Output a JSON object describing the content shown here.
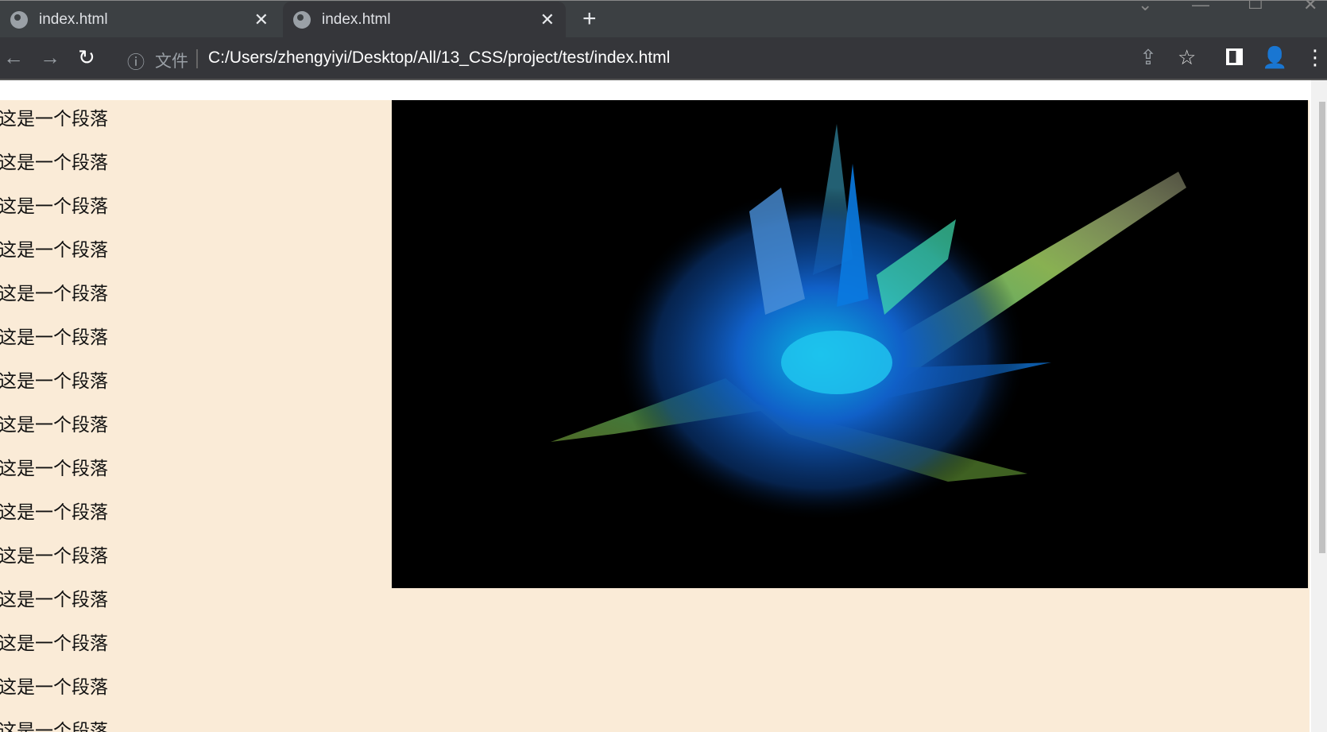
{
  "tabs": [
    {
      "title": "index.html"
    },
    {
      "title": "index.html"
    }
  ],
  "toolbar": {
    "file_label": "文件",
    "url": "C:/Users/zhengyiyi/Desktop/All/13_CSS/project/test/index.html"
  },
  "page": {
    "paragraphs": [
      "这是一个段落",
      "这是一个段落",
      "这是一个段落",
      "这是一个段落",
      "这是一个段落",
      "这是一个段落",
      "这是一个段落",
      "这是一个段落",
      "这是一个段落",
      "这是一个段落",
      "这是一个段落",
      "这是一个段落",
      "这是一个段落",
      "这是一个段落",
      "这是一个段落"
    ],
    "background": "#faebd7"
  }
}
